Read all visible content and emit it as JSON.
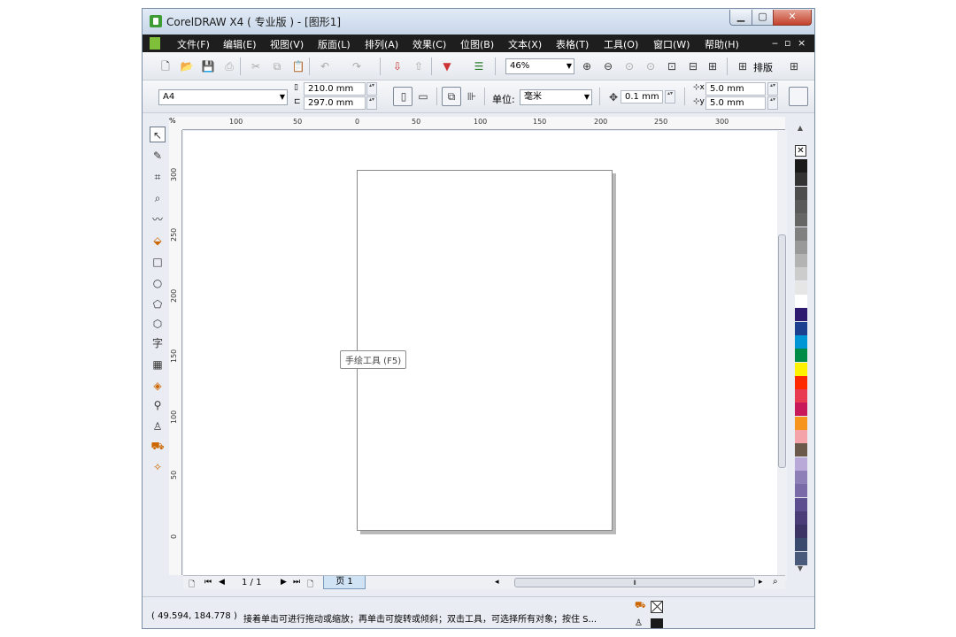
{
  "window": {
    "title": "CorelDRAW X4 ( 专业版 ) - [图形1]",
    "min_glyph": "▁",
    "max_glyph": "▢",
    "close_glyph": "✕"
  },
  "menubar": {
    "items": [
      "文件(F)",
      "编辑(E)",
      "视图(V)",
      "版面(L)",
      "排列(A)",
      "效果(C)",
      "位图(B)",
      "文本(X)",
      "表格(T)",
      "工具(O)",
      "窗口(W)",
      "帮助(H)"
    ],
    "mdi_min": "‒",
    "mdi_restore": "▫",
    "mdi_close": "×"
  },
  "toolbar": {
    "zoom_value": "46%",
    "layout_label": "排版"
  },
  "property_bar": {
    "paper_size": "A4",
    "width": "210.0 mm",
    "height": "297.0 mm",
    "units_label": "单位:",
    "units_value": "毫米",
    "nudge": "0.1 mm",
    "dup_x": "5.0 mm",
    "dup_y": "5.0 mm"
  },
  "toolbox": {
    "text_tool_glyph": "字"
  },
  "ruler": {
    "unit_marker": "%",
    "h_ticks": [
      "100",
      "50",
      "0",
      "50",
      "100",
      "150",
      "200",
      "250",
      "300"
    ],
    "v_ticks": [
      "300",
      "250",
      "200",
      "150",
      "100",
      "50",
      "0"
    ]
  },
  "canvas": {
    "tooltip": "手绘工具 (F5)"
  },
  "page_nav": {
    "page_counter": "1 / 1",
    "page_tab": "页 1"
  },
  "statusbar": {
    "coords": "( 49.594, 184.778 )",
    "hint": "接着单击可进行拖动或缩放；再单击可旋转或倾斜；双击工具，可选择所有对象；按住 S..."
  },
  "palette": {
    "colors": [
      "#1a1a1a",
      "#333333",
      "#4d4d4d",
      "#5a5a5a",
      "#666666",
      "#808080",
      "#999999",
      "#b3b3b3",
      "#cccccc",
      "#e6e6e6",
      "#ffffff",
      "#2e1a6e",
      "#1c3f8f",
      "#0096d6",
      "#008c46",
      "#fff200",
      "#ff2a00",
      "#e83a50",
      "#c8195a",
      "#f7941d",
      "#f4a3a8",
      "#6b5a4b",
      "#b9a9d9",
      "#8f7fb9",
      "#7a6aa8",
      "#5d4f8f",
      "#4a3d78",
      "#3d3466",
      "#3a4a6e",
      "#4a5a7a"
    ]
  }
}
